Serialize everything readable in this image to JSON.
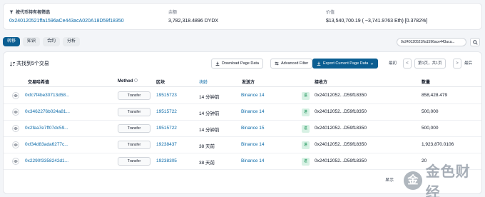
{
  "summary": {
    "holder": {
      "label": "按代币持有者筛选",
      "value": "0x240120521ffa1596aCe443acA020A18D59f18350"
    },
    "balance": {
      "label": "余额",
      "value": "3,782,318.4896 DYDX"
    },
    "value": {
      "label": "价值",
      "value": "$13,540,700.19 ( ~3,741.9763 Eth) [0.3782%]"
    }
  },
  "tabs": [
    {
      "label": "转移"
    },
    {
      "label": "知识"
    },
    {
      "label": "合约"
    },
    {
      "label": "分析"
    }
  ],
  "search": {
    "address": "0x240120521ffa1596ace443aca..."
  },
  "toolbar": {
    "found": "共找到5个交易",
    "download": "Download Page Data",
    "advanced": "Advanced Filter",
    "export": "Export Current Page Data",
    "first": "最初",
    "page_info": "第1页，共1页",
    "last": "最后"
  },
  "table": {
    "headers": {
      "hash": "交易哈希值",
      "method": "Method",
      "block": "区块",
      "age": "块龄",
      "from": "发送方",
      "to": "接收方",
      "amount": "数量"
    },
    "rows": [
      {
        "hash": "0xfc7f4be30713d58...",
        "method": "Transfer",
        "block": "19515723",
        "age": "14 分钟前",
        "from": "Binance 14",
        "dir": "进",
        "to": "0x24012052...D59f18350",
        "amount": "858,428.479"
      },
      {
        "hash": "0x3462276b024a81...",
        "method": "Transfer",
        "block": "19515722",
        "age": "14 分钟前",
        "from": "Binance 14",
        "dir": "进",
        "to": "0x24012052...D59f18350",
        "amount": "500,000"
      },
      {
        "hash": "0x2fea7e7ff07dc59...",
        "method": "Transfer",
        "block": "19515722",
        "age": "14 分钟前",
        "from": "Binance 15",
        "dir": "进",
        "to": "0x24012052...D59f18350",
        "amount": "500,000"
      },
      {
        "hash": "0xf34d83ada6277c...",
        "method": "Transfer",
        "block": "19238437",
        "age": "38 天前",
        "from": "Binance 14",
        "dir": "进",
        "to": "0x24012052...D59f18350",
        "amount": "1,923,870.0106"
      },
      {
        "hash": "0x2290f3358242d1...",
        "method": "Transfer",
        "block": "19238305",
        "age": "38 天前",
        "from": "Binance 14",
        "dir": "进",
        "to": "0x24012052...D59f18350",
        "amount": "20"
      }
    ]
  },
  "footer": {
    "show": "显示"
  },
  "watermark": {
    "logo": "金",
    "text": "金色财经"
  },
  "colors": {
    "primary": "#0b5e92",
    "link": "#0b6aa8",
    "in_badge_bg": "#d7f1e4",
    "in_badge_fg": "#0a8a4a"
  }
}
